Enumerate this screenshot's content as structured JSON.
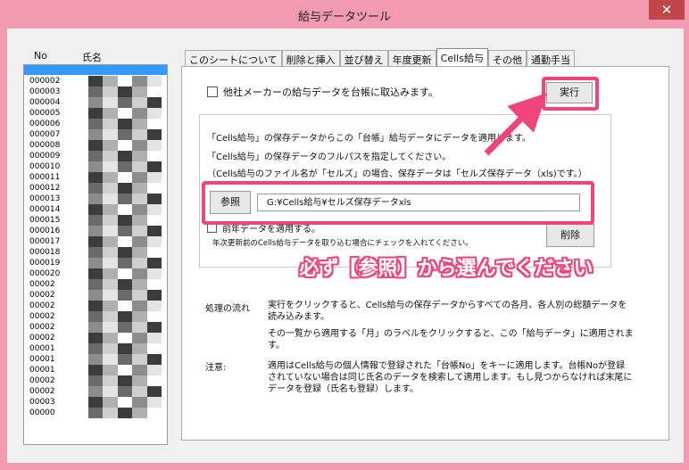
{
  "window": {
    "title": "給与データツール",
    "close_glyph": "✕"
  },
  "list": {
    "headers": {
      "no": "No",
      "name": "氏名"
    },
    "rows": [
      "000002",
      "000003",
      "000004",
      "000005",
      "000006",
      "000007",
      "000008",
      "000009",
      "000010",
      "000011",
      "000012",
      "000013",
      "000014",
      "000015",
      "000016",
      "000017",
      "000018",
      "000019",
      "000020",
      "00002",
      "00002",
      "00002",
      "00002",
      "00002",
      "00002",
      "00001",
      "00001",
      "00001",
      "00002",
      "00002",
      "00003",
      "00000"
    ]
  },
  "tabs": [
    {
      "label": "このシートについて",
      "active": false
    },
    {
      "label": "削除と挿入",
      "active": false
    },
    {
      "label": "並び替え",
      "active": false
    },
    {
      "label": "年度更新",
      "active": false
    },
    {
      "label": "Cells給与",
      "active": true
    },
    {
      "label": "その他",
      "active": false
    },
    {
      "label": "通勤手当",
      "active": false
    }
  ],
  "panel": {
    "import_checkbox_label": "他社メーカーの給与データを台帳に取込みます。",
    "exec_button": "実行",
    "info_lines": [
      "「Cells給与」の保存データからこの「台帳」給与データにデータを適用します。",
      "「Cells給与」の保存データのフルパスを指定してください。",
      "（Cells給与のファイル名が「セルズ」の場合、保存データは「セルズ保存データ（xls)です。）"
    ],
    "ref_button": "参照",
    "path_value": "G:¥Cells給与¥セルズ保存データxls",
    "prev_year_checkbox_label": "前年データを適用する。",
    "prev_year_note": "年次更新前のCells給与データを取り込む場合にチェックを入れてください。",
    "delete_button": "削除",
    "flow_label": "処理の流れ",
    "flow_text_1": "実行をクリックすると、Cells給与の保存データからすべての各月、各人別の総額データを読み込みます。",
    "flow_text_2": "その一覧から適用する「月」のラベルをクリックすると、この「給与データ」に適用されます。",
    "note_label": "注意:",
    "note_text": "適用はCells給与の個人情報で登録された「台帳No」をキーに適用します。台帳Noが登録されていない場合は同じ氏名のデータを検索して適用します。もし見つからなければ末尾にデータを登録（氏名も登録）します。"
  },
  "annotation": {
    "banner": "必ず【参照】から選んでください",
    "color": "#f0457a"
  }
}
